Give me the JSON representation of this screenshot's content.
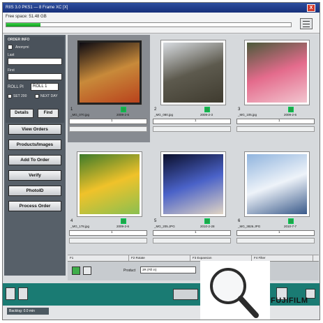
{
  "window": {
    "title": "RIIS 3.0   PKS1 — 8 Frame XC  [X]",
    "close_label": "X"
  },
  "storage": {
    "label": "Free space: 51.48 GB",
    "progress": 0.12
  },
  "order_info": {
    "title": "ORDER INFO",
    "customer_label": "Anonymi",
    "last_label": "Last",
    "first_label": "First",
    "roll_label": "ROLL PI",
    "roll_value": "ROLL 1",
    "set_label": "SET 200",
    "next_label": "NEXT DAY",
    "details_button": "Details",
    "find_button": "Find"
  },
  "nav": {
    "view_orders": "View Orders",
    "products_images": "Products/Images",
    "add_to_order": "Add To Order",
    "verify": "Verify",
    "photo_id": "PhotoID",
    "process_order": "Process Order"
  },
  "thumbnails": [
    {
      "number": "1",
      "filename": "_MG_070.jpg",
      "date": "2009-2-6",
      "qty": "1",
      "selected": true,
      "colors": [
        "#0c0a12",
        "#c88a3a",
        "#b9421c"
      ]
    },
    {
      "number": "2",
      "filename": "_MG_080.jpg",
      "date": "2009-2-3",
      "qty": "1",
      "selected": false,
      "colors": [
        "#d7dbe0",
        "#5d5a4e",
        "#3f3b2f"
      ]
    },
    {
      "number": "3",
      "filename": "_MG_105.jpg",
      "date": "2009-2-6",
      "qty": "1",
      "selected": false,
      "colors": [
        "#4b5a3a",
        "#e46b8c",
        "#f2c5cf"
      ]
    },
    {
      "number": "4",
      "filename": "_MG_178.jpg",
      "date": "2009-2-6",
      "qty": "1",
      "selected": false,
      "colors": [
        "#3c7a2a",
        "#f0c22a",
        "#8ac050"
      ]
    },
    {
      "number": "5",
      "filename": "_MG_205.JPG",
      "date": "2010-2-28",
      "qty": "1",
      "selected": false,
      "colors": [
        "#0a0e2a",
        "#4a62c8",
        "#e0d4c4"
      ]
    },
    {
      "number": "6",
      "filename": "_MG_3826.JPG",
      "date": "2010-7-7",
      "qty": "1",
      "selected": false,
      "colors": [
        "#90b4de",
        "#eef3f9",
        "#3a5a8a"
      ]
    }
  ],
  "toolbar_tabs": [
    "F1",
    "F2 Rotate",
    "F3 Expansion",
    "F4 Filter"
  ],
  "product": {
    "label": "Product",
    "value": "3R (Fill in)"
  },
  "status": {
    "backlog": "Backlog: 0.0 min"
  },
  "brand": {
    "logo_text": "FUJIFILM"
  }
}
